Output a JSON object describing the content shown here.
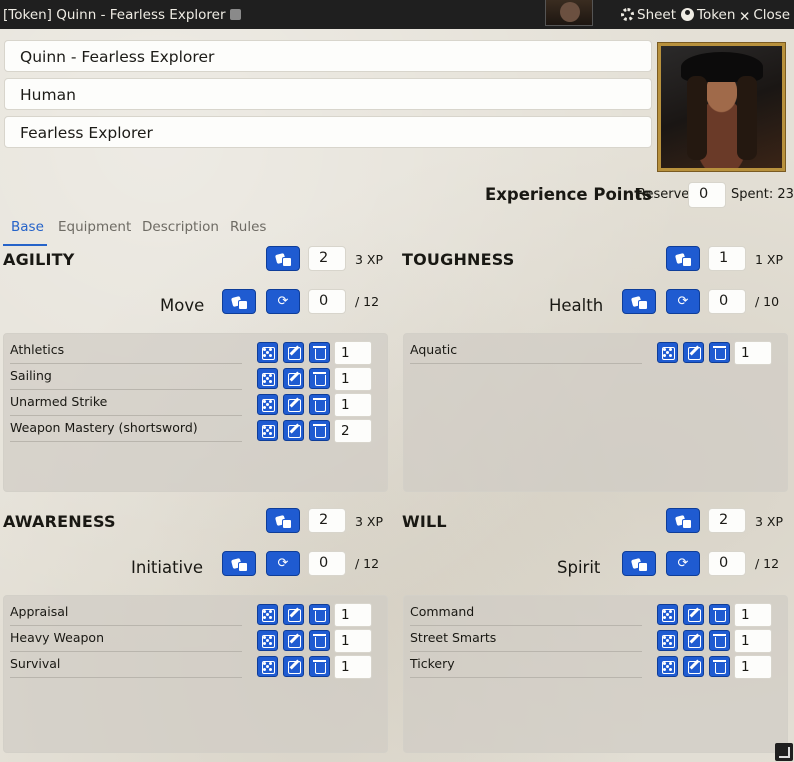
{
  "window": {
    "title": "[Token] Quinn - Fearless Explorer",
    "buttons": {
      "sheet": "Sheet",
      "token": "Token",
      "close": "Close"
    }
  },
  "profile": {
    "name": "Quinn - Fearless Explorer",
    "ancestry": "Human",
    "concept": "Fearless Explorer"
  },
  "xp": {
    "label": "Experience Points",
    "reserve_label": "Reserve",
    "reserve_value": "0",
    "spent_label": "Spent: 23"
  },
  "tabs": [
    "Base",
    "Equipment",
    "Description",
    "Rules"
  ],
  "attributes": {
    "agility": {
      "name": "AGILITY",
      "value": "2",
      "xp": "3 XP",
      "derived": {
        "label": "Move",
        "value": "0",
        "max": "/ 12"
      },
      "skills": [
        {
          "name": "Athletics",
          "value": "1"
        },
        {
          "name": "Sailing",
          "value": "1"
        },
        {
          "name": "Unarmed Strike",
          "value": "1"
        },
        {
          "name": "Weapon Mastery (shortsword)",
          "value": "2"
        }
      ]
    },
    "toughness": {
      "name": "TOUGHNESS",
      "value": "1",
      "xp": "1 XP",
      "derived": {
        "label": "Health",
        "value": "0",
        "max": "/ 10"
      },
      "skills": [
        {
          "name": "Aquatic",
          "value": "1"
        }
      ]
    },
    "awareness": {
      "name": "AWARENESS",
      "value": "2",
      "xp": "3 XP",
      "derived": {
        "label": "Initiative",
        "value": "0",
        "max": "/ 12"
      },
      "skills": [
        {
          "name": "Appraisal",
          "value": "1"
        },
        {
          "name": "Heavy Weapon",
          "value": "1"
        },
        {
          "name": "Survival",
          "value": "1"
        }
      ]
    },
    "will": {
      "name": "WILL",
      "value": "2",
      "xp": "3 XP",
      "derived": {
        "label": "Spirit",
        "value": "0",
        "max": "/ 12"
      },
      "skills": [
        {
          "name": "Command",
          "value": "1"
        },
        {
          "name": "Street Smarts",
          "value": "1"
        },
        {
          "name": "Tickery",
          "value": "1"
        }
      ]
    }
  },
  "colors": {
    "accent": "#1f5bd1",
    "tab_active": "#2563c9",
    "titlebar": "#1f1f1f"
  },
  "icons": [
    "gear-icon",
    "user-circle-icon",
    "close-icon",
    "dice-icon",
    "refresh-icon",
    "edit-icon",
    "trash-icon",
    "resize-icon"
  ]
}
